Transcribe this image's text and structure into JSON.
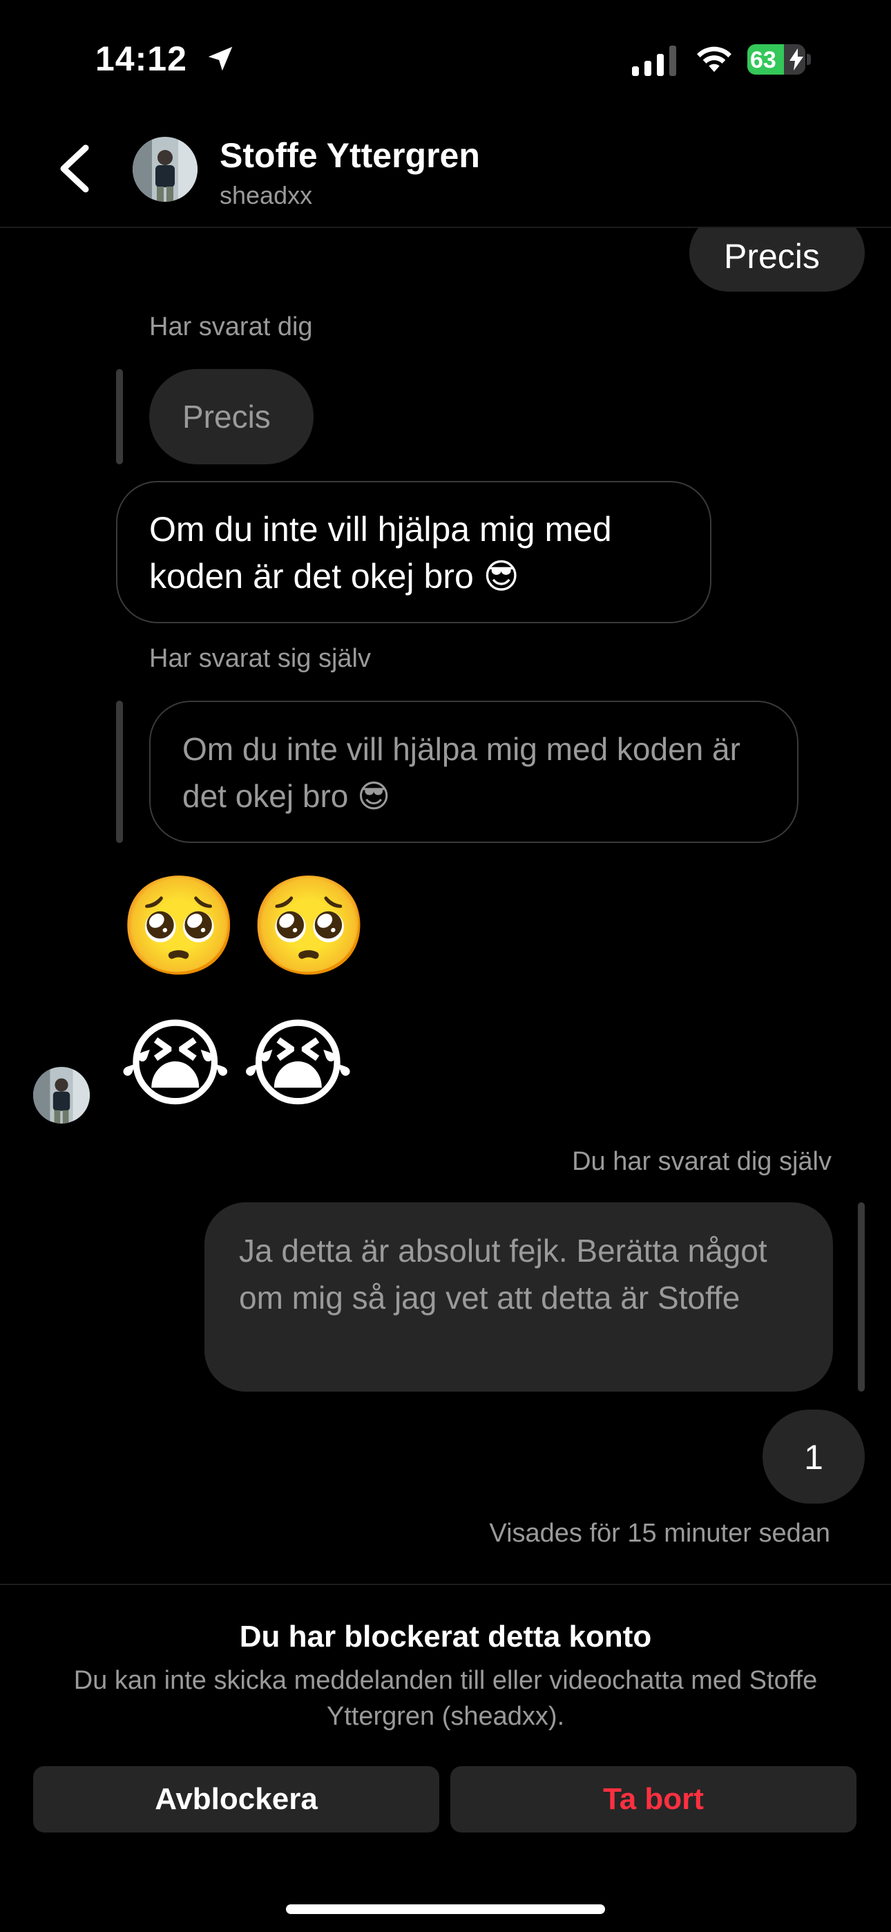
{
  "status_bar": {
    "time": "14:12",
    "battery_percent": "63",
    "battery_level": 0.63
  },
  "header": {
    "name": "Stoffe Yttergren",
    "username": "sheadxx"
  },
  "messages": {
    "m1_text": "Precis",
    "m2_reply_label": "Har svarat dig",
    "m2_quoted": "Precis",
    "m2_text": "Om du inte vill hjälpa mig med koden är det okej bro 😎",
    "m3_reply_label": "Har svarat sig själv",
    "m3_quoted": "Om du inte vill hjälpa mig med koden är det okej bro 😎",
    "m4_emoji": "🥺🥺",
    "m5_emoji": "😭😭",
    "m6_reply_label": "Du har svarat dig själv",
    "m6_quoted": "Ja detta är absolut fejk. Berätta något om mig så jag vet att detta är Stoffe",
    "m7_text": "1",
    "seen_text": "Visades för 15 minuter sedan"
  },
  "blocked": {
    "title": "Du har blockerat detta konto",
    "description": "Du kan inte skicka meddelanden till eller videochatta med Stoffe Yttergren (sheadxx).",
    "unblock_label": "Avblockera",
    "delete_label": "Ta bort"
  },
  "colors": {
    "background": "#000000",
    "bubble_gray": "#262626",
    "danger": "#ff3040",
    "battery_green": "#34c759"
  }
}
